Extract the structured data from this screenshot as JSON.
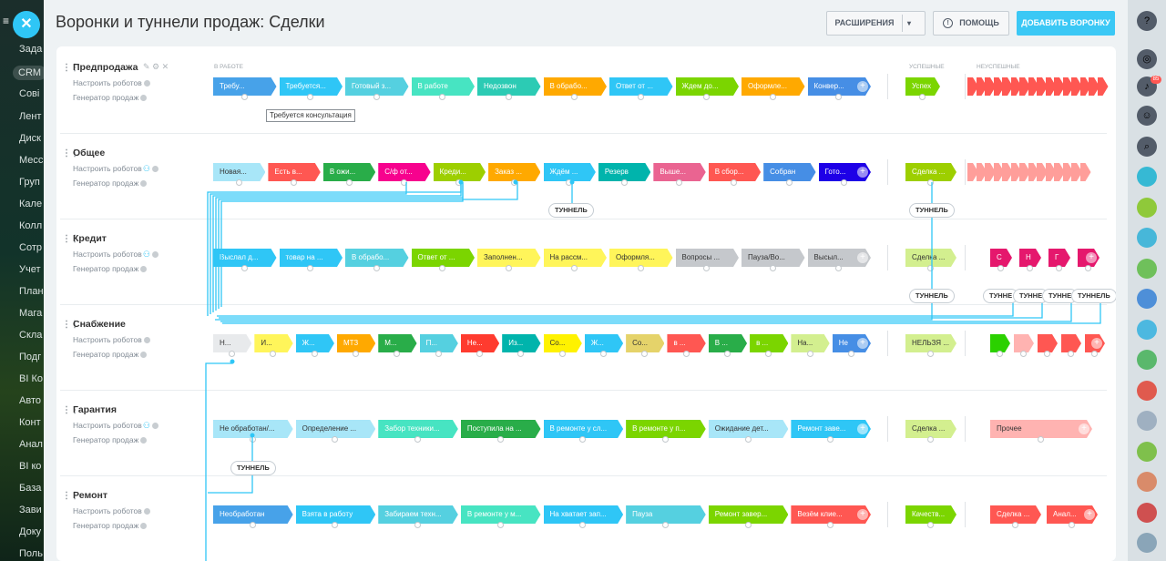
{
  "leftnav": {
    "items": [
      "Зада",
      "CRM",
      "Сові",
      "Лент",
      "Диск",
      "Месс",
      "Груп",
      "Кале",
      "Колл",
      "Сотр",
      "Учет",
      "План",
      "Мага",
      "Скла",
      "Подг",
      "BI Ко",
      "Авто",
      "Конт",
      "Анал",
      "BI кo",
      "База",
      "Зави",
      "Доку",
      "Поль"
    ]
  },
  "header": {
    "title": "Воронки и туннели продаж: Сделки",
    "extensions_label": "РАСШИРЕНИЯ",
    "help_label": "ПОМОЩЬ",
    "add_funnel_label": "ДОБАВИТЬ ВОРОНКУ"
  },
  "columns": {
    "in_work": "В РАБОТЕ",
    "success": "УСПЕШНЫЕ",
    "fail": "НЕУСПЕШНЫЕ"
  },
  "tooltip": "Требуется консультация",
  "tunnel_label": "ТУННЕЛЬ",
  "tunnel_short": "ТУННЕ",
  "badge": "85",
  "colors": {
    "blue": "#2fc6f6",
    "accent": "#3bc8f5",
    "line": "#2fc6f6"
  },
  "funnels": [
    {
      "name": "Предпродажа",
      "robots": "Настроить роботов",
      "generator": "Генератор продаж",
      "stages": [
        [
          "Требу...",
          "#47a2e9"
        ],
        [
          "Требуется...",
          "#2fc6f6"
        ],
        [
          "Готовый з...",
          "#55d0e0"
        ],
        [
          "В работе",
          "#47e4c2"
        ],
        [
          "Недозвон",
          "#2ccbb4"
        ],
        [
          "В обрабо...",
          "#ffa900"
        ],
        [
          "Ответ от ...",
          "#2fc6f6"
        ],
        [
          "Ждем до...",
          "#7bd500"
        ],
        [
          "Оформле...",
          "#ffa900"
        ],
        [
          "Конвер...",
          "#468ee5"
        ]
      ],
      "success": [
        [
          "Успех",
          "#7bd500"
        ]
      ]
    },
    {
      "name": "Общее",
      "robots": "Настроить роботов",
      "generator": "Генератор продаж",
      "stages": [
        [
          "Новая...",
          "#a8e6f8"
        ],
        [
          "Есть в...",
          "#ff5752"
        ],
        [
          "В ожи...",
          "#29ad49"
        ],
        [
          "С/ф от...",
          "#f7028e"
        ],
        [
          "Креди...",
          "#9dcf00"
        ],
        [
          "Заказ ...",
          "#ffa900"
        ],
        [
          "Ждём ...",
          "#2fc6f6"
        ],
        [
          "Резерв",
          "#00b4ac"
        ],
        [
          "Выше...",
          "#ea6491"
        ],
        [
          "В сбор...",
          "#ff5752"
        ],
        [
          "Собран",
          "#468ee5"
        ],
        [
          "Гото...",
          "#1e00e7"
        ]
      ],
      "success": [
        [
          "Сделка ...",
          "#9dcf00"
        ]
      ]
    },
    {
      "name": "Кредит",
      "robots": "Настроить роботов",
      "generator": "Генератор продаж",
      "stages": [
        [
          "Выслал д...",
          "#2fc6f6"
        ],
        [
          "товар на ...",
          "#2fc6f6"
        ],
        [
          "В обрабо...",
          "#55d0e0"
        ],
        [
          "Ответ от ...",
          "#7bd500"
        ],
        [
          "Заполнен...",
          "#fff55a"
        ],
        [
          "На рассм...",
          "#fff55a"
        ],
        [
          "Оформля...",
          "#fff55a"
        ],
        [
          "Вопросы ...",
          "#c5c8cc"
        ],
        [
          "Пауза/Во...",
          "#c5c8cc"
        ],
        [
          "Высыл...",
          "#c5c8cc"
        ]
      ],
      "success": [
        [
          "Сделка ...",
          "#d3ef8f"
        ]
      ],
      "fail": [
        [
          "С",
          "#e5186d"
        ],
        [
          "Н",
          "#e5186d"
        ],
        [
          "Г",
          "#e5186d"
        ],
        [
          "",
          "#e5186d"
        ]
      ]
    },
    {
      "name": "Снабжение",
      "robots": "Настроить роботов",
      "generator": "Генератор продаж",
      "stages": [
        [
          "Н...",
          "#e8eaec"
        ],
        [
          "И...",
          "#fff55a"
        ],
        [
          "Ж...",
          "#2fc6f6"
        ],
        [
          "МТЗ",
          "#ffa900"
        ],
        [
          "М...",
          "#29ad49"
        ],
        [
          "П...",
          "#55d0e0"
        ],
        [
          "Не...",
          "#ff3b2f"
        ],
        [
          "Из...",
          "#00b4ac"
        ],
        [
          "Со...",
          "#fff200"
        ],
        [
          "Ж...",
          "#2fc6f6"
        ],
        [
          "Со...",
          "#e5d36a"
        ],
        [
          "в ...",
          "#ff5752"
        ],
        [
          "В ...",
          "#29ad49"
        ],
        [
          "в ...",
          "#7bd500"
        ],
        [
          "На...",
          "#d3ef8f"
        ],
        [
          "Не",
          "#468ee5"
        ]
      ],
      "success": [
        [
          "НЕЛЬЗЯ ...",
          "#d3ef8f"
        ]
      ],
      "fail": [
        [
          "",
          "#2bd100"
        ],
        [
          "",
          "#ffb3b1"
        ],
        [
          "",
          "#ff5752"
        ],
        [
          "",
          "#ff5752"
        ],
        [
          "",
          "#ff5752"
        ]
      ]
    },
    {
      "name": "Гарантия",
      "robots": "Настроить роботов",
      "generator": "Генератор продаж",
      "stages": [
        [
          "Не обработан/...",
          "#a8e6f8"
        ],
        [
          "Определение ...",
          "#a8e6f8"
        ],
        [
          "Забор техники...",
          "#47e4c2"
        ],
        [
          "Поступила на ...",
          "#29ad49"
        ],
        [
          "В ремонте у сл...",
          "#2fc6f6"
        ],
        [
          "В ремонте у п...",
          "#7bd500"
        ],
        [
          "Ожидание дет...",
          "#a8e6f8"
        ],
        [
          "Ремонт заве...",
          "#2fc6f6"
        ]
      ],
      "success": [
        [
          "Сделка ...",
          "#d3ef8f"
        ]
      ],
      "fail": [
        [
          "Прочее",
          "#ffb3b1"
        ]
      ]
    },
    {
      "name": "Ремонт",
      "robots": "Настроить роботов",
      "generator": "Генератор продаж",
      "stages": [
        [
          "Необработан",
          "#47a2e9"
        ],
        [
          "Взята в работу",
          "#2fc6f6"
        ],
        [
          "Забираем техн...",
          "#55d0e0"
        ],
        [
          "В ремонте у м...",
          "#47e4c2"
        ],
        [
          "На хватает зап...",
          "#2fc6f6"
        ],
        [
          "Пауза",
          "#55d0e0"
        ],
        [
          "Ремонт завер...",
          "#7bd500"
        ],
        [
          "Везём клие...",
          "#ff5752"
        ]
      ],
      "success": [
        [
          "Качеств...",
          "#7bd500"
        ]
      ],
      "fail": [
        [
          "Сделка ...",
          "#ff5752"
        ],
        [
          "Анал...",
          "#ff5752"
        ]
      ]
    }
  ]
}
